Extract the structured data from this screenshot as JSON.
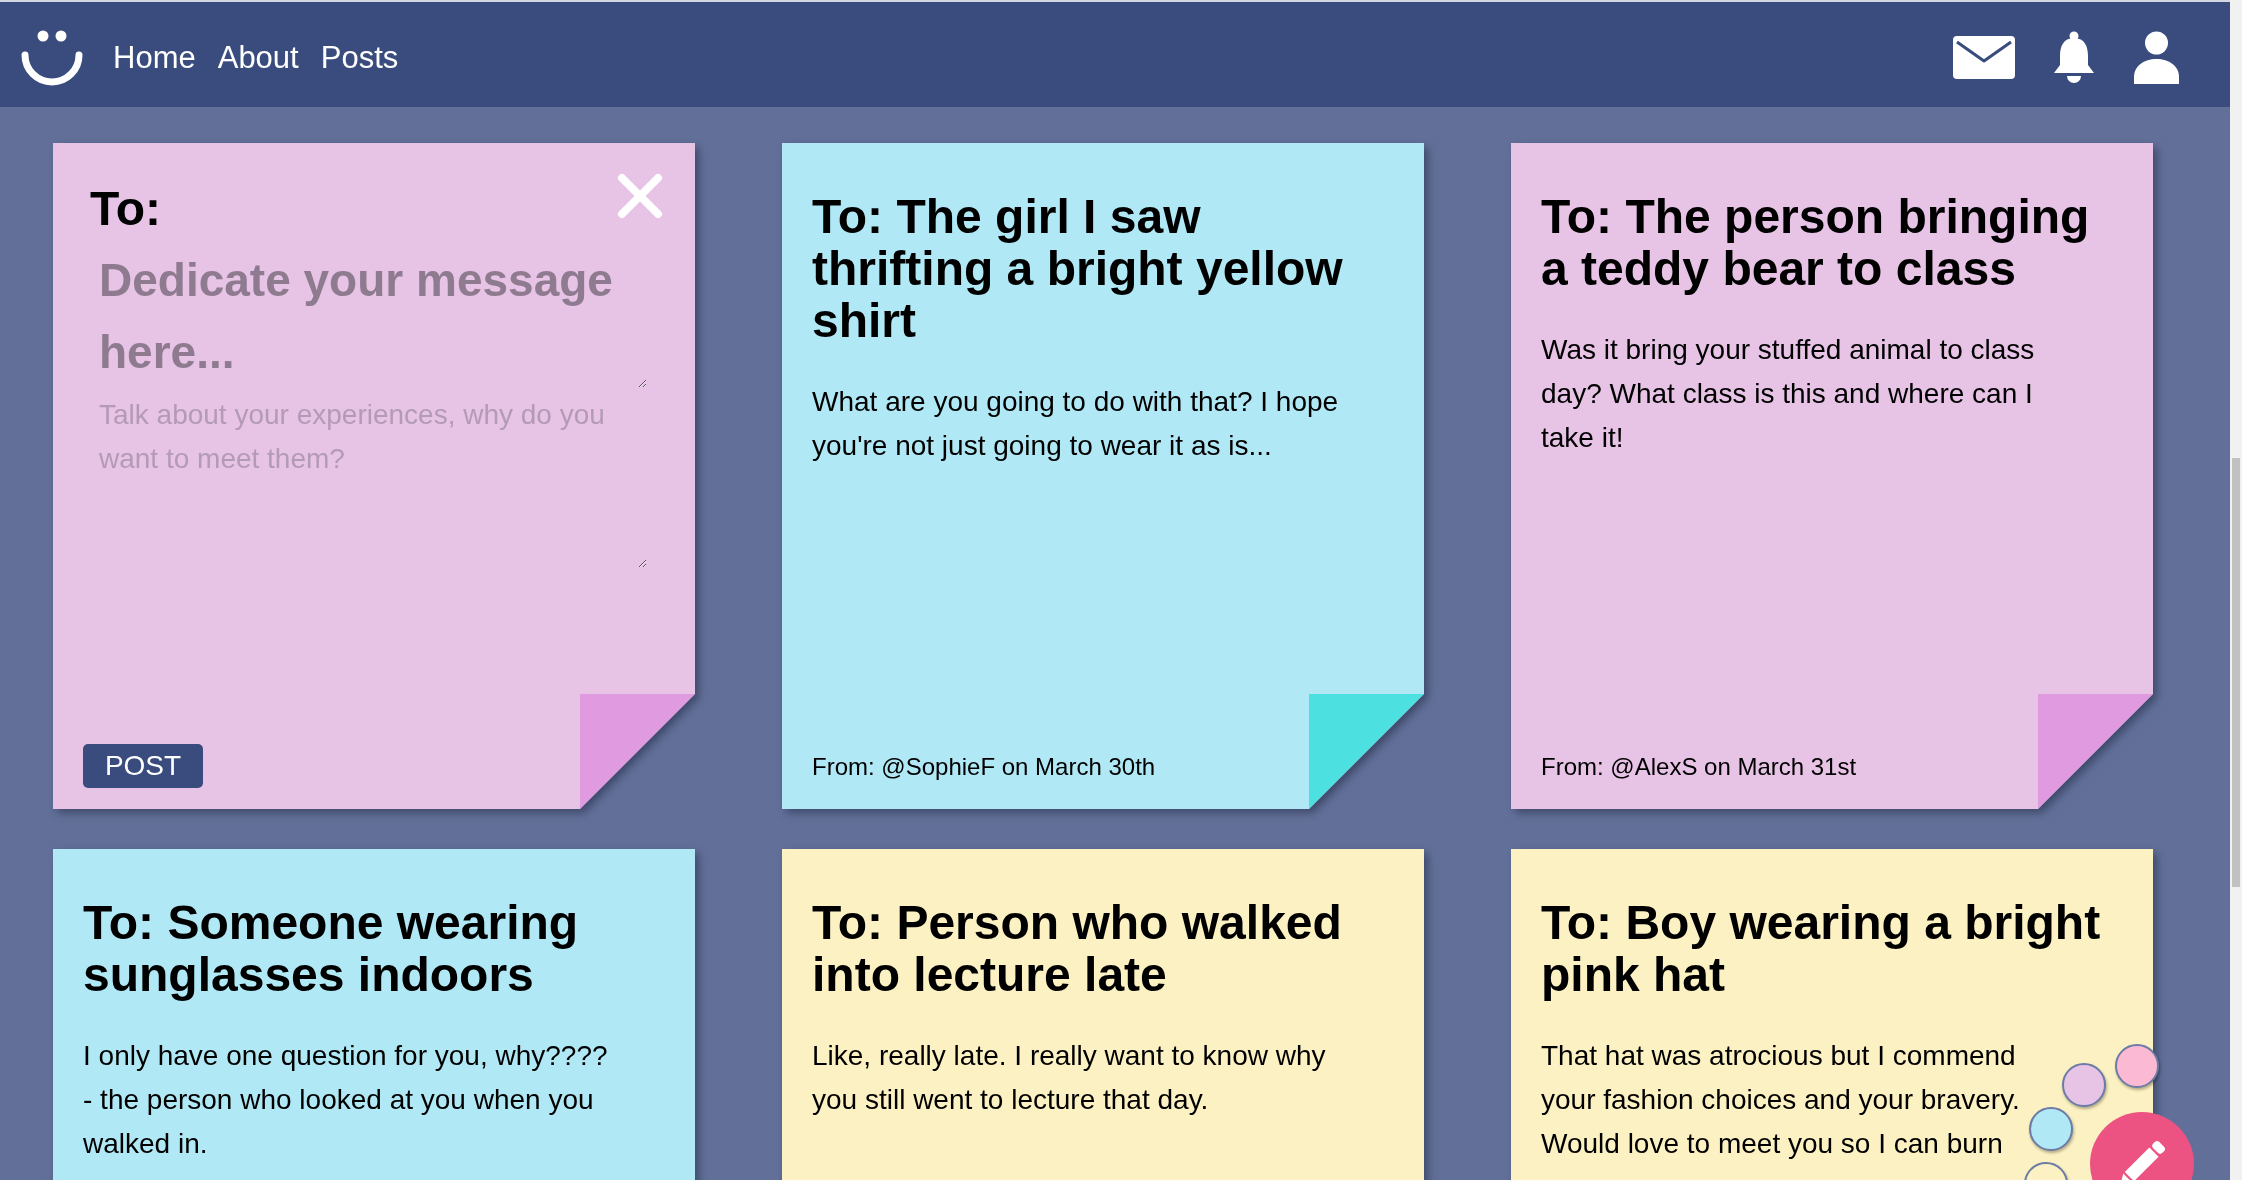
{
  "nav": {
    "links": [
      "Home",
      "About",
      "Posts"
    ]
  },
  "composer": {
    "color": "#e7c3e6",
    "to_label": "To:",
    "recipient": {
      "placeholder": "Dedicate your message here..."
    },
    "message": {
      "placeholder": "Talk about your experiences, why do you want to meet them?"
    },
    "post_button": "POST"
  },
  "posts": [
    {
      "color": "#b0e8f5",
      "title": "To: The girl I saw thrifting a bright yellow shirt",
      "body": "What are you going to do with that? I hope you're not just going to wear it as is...",
      "from": "From: @SophieF on March 30th"
    },
    {
      "color": "#e7c3e6",
      "title": "To: The person bringing a teddy bear to class",
      "body": "Was it bring your stuffed animal to class day? What class is this and where can I take it!",
      "from": "From: @AlexS on March 31st"
    },
    {
      "color": "#b0e8f5",
      "title": "To: Someone wearing sunglasses indoors",
      "body": "I only have one question for you, why???? - the person who looked at you when you walked in."
    },
    {
      "color": "#fcf1c2",
      "title": "To: Person who walked into lecture late",
      "body": "Like, really late. I really want to know why you still went to lecture that day."
    },
    {
      "color": "#fcf1c2",
      "title": "To: Boy wearing a bright pink hat",
      "body": "That hat was atrocious but I commend your fashion choices and your bravery. Would love to meet you so I can burn"
    }
  ],
  "color_picker": [
    {
      "color": "#fbb9d3"
    },
    {
      "color": "#e7c3e6"
    },
    {
      "color": "#b0e8f5"
    },
    {
      "color": "#fcf1c2"
    }
  ]
}
